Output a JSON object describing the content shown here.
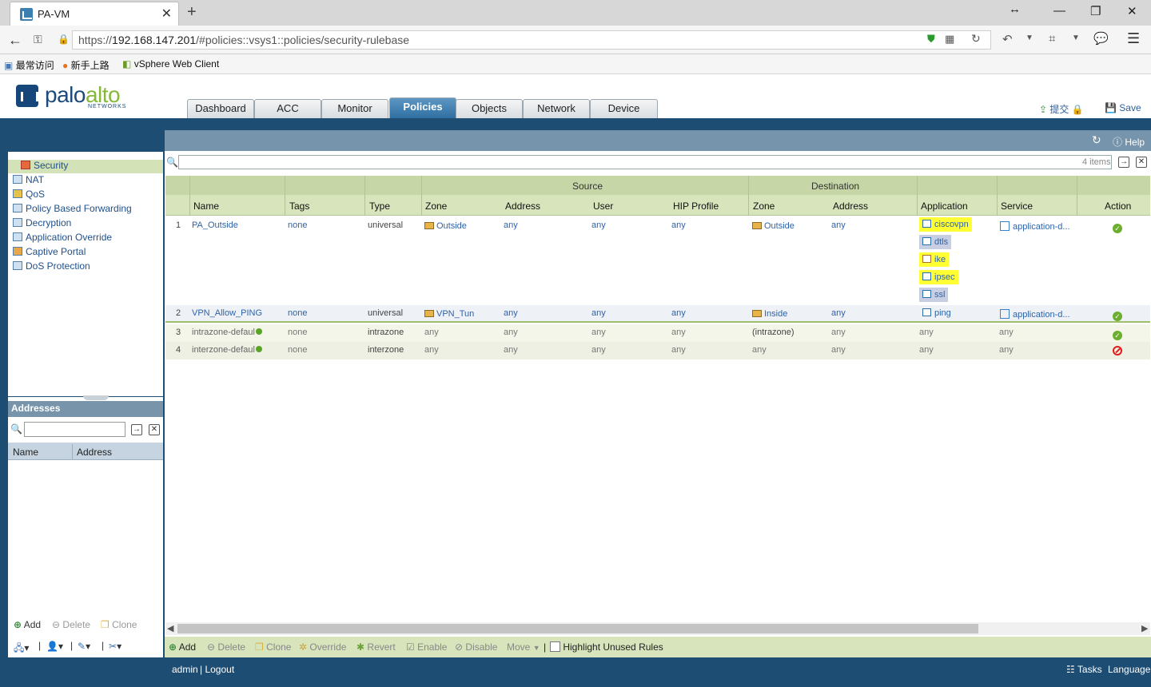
{
  "browser": {
    "tab_title": "PA-VM",
    "url_prefix": "https://",
    "url_host": "192.168.147.201",
    "url_path": "/#policies::vsys1::policies/security-rulebase",
    "bookmarks": [
      "最常访问",
      "新手上路",
      "vSphere Web Client"
    ]
  },
  "app": {
    "logo_main": "palo",
    "logo_accent": "alto",
    "logo_sub": "NETWORKS",
    "nav_tabs": [
      "Dashboard",
      "ACC",
      "Monitor",
      "Policies",
      "Objects",
      "Network",
      "Device"
    ],
    "active_tab": "Policies",
    "commit_label": "提交",
    "save_label": "Save"
  },
  "left_nav": {
    "items": [
      "Security",
      "NAT",
      "QoS",
      "Policy Based Forwarding",
      "Decryption",
      "Application Override",
      "Captive Portal",
      "DoS Protection"
    ],
    "selected": "Security"
  },
  "addresses_panel": {
    "title": "Addresses",
    "columns": [
      "Name",
      "Address"
    ],
    "actions": [
      "Add",
      "Delete",
      "Clone"
    ]
  },
  "main": {
    "help_label": "Help",
    "item_count": "4 items",
    "group_headers": [
      "Source",
      "Destination"
    ],
    "columns": [
      "Name",
      "Tags",
      "Type",
      "Zone",
      "Address",
      "User",
      "HIP Profile",
      "Zone",
      "Address",
      "Application",
      "Service",
      "Action"
    ],
    "rules": [
      {
        "num": "1",
        "name": "PA_Outside",
        "tags": "none",
        "type": "universal",
        "src_zone": "Outside",
        "src_addr": "any",
        "user": "any",
        "hip": "any",
        "dst_zone": "Outside",
        "dst_addr": "any",
        "apps": [
          "ciscovpn",
          "dtls",
          "ike",
          "ipsec",
          "ssl"
        ],
        "service": "application-d...",
        "action": "allow"
      },
      {
        "num": "2",
        "name": "VPN_Allow_PING",
        "tags": "none",
        "type": "universal",
        "src_zone": "VPN_Tun",
        "src_addr": "any",
        "user": "any",
        "hip": "any",
        "dst_zone": "Inside",
        "dst_addr": "any",
        "apps": [
          "ping"
        ],
        "service": "application-d...",
        "action": "allow"
      },
      {
        "num": "3",
        "name": "intrazone-defaul",
        "tags": "none",
        "type": "intrazone",
        "src_zone": "any",
        "src_addr": "any",
        "user": "any",
        "hip": "any",
        "dst_zone": "(intrazone)",
        "dst_addr": "any",
        "app": "any",
        "service": "any",
        "action": "allow"
      },
      {
        "num": "4",
        "name": "interzone-defaul",
        "tags": "none",
        "type": "interzone",
        "src_zone": "any",
        "src_addr": "any",
        "user": "any",
        "hip": "any",
        "dst_zone": "any",
        "dst_addr": "any",
        "app": "any",
        "service": "any",
        "action": "deny"
      }
    ],
    "bottom_actions": [
      "Add",
      "Delete",
      "Clone",
      "Override",
      "Revert",
      "Enable",
      "Disable",
      "Move"
    ],
    "highlight_label": "Highlight Unused Rules"
  },
  "status": {
    "user": "admin",
    "logout": "| Logout",
    "tasks": "Tasks",
    "language": "Language"
  },
  "colors": {
    "brand_blue": "#1e4d74",
    "accent_green": "#86b83c",
    "highlight_yellow": "#ffff33"
  }
}
